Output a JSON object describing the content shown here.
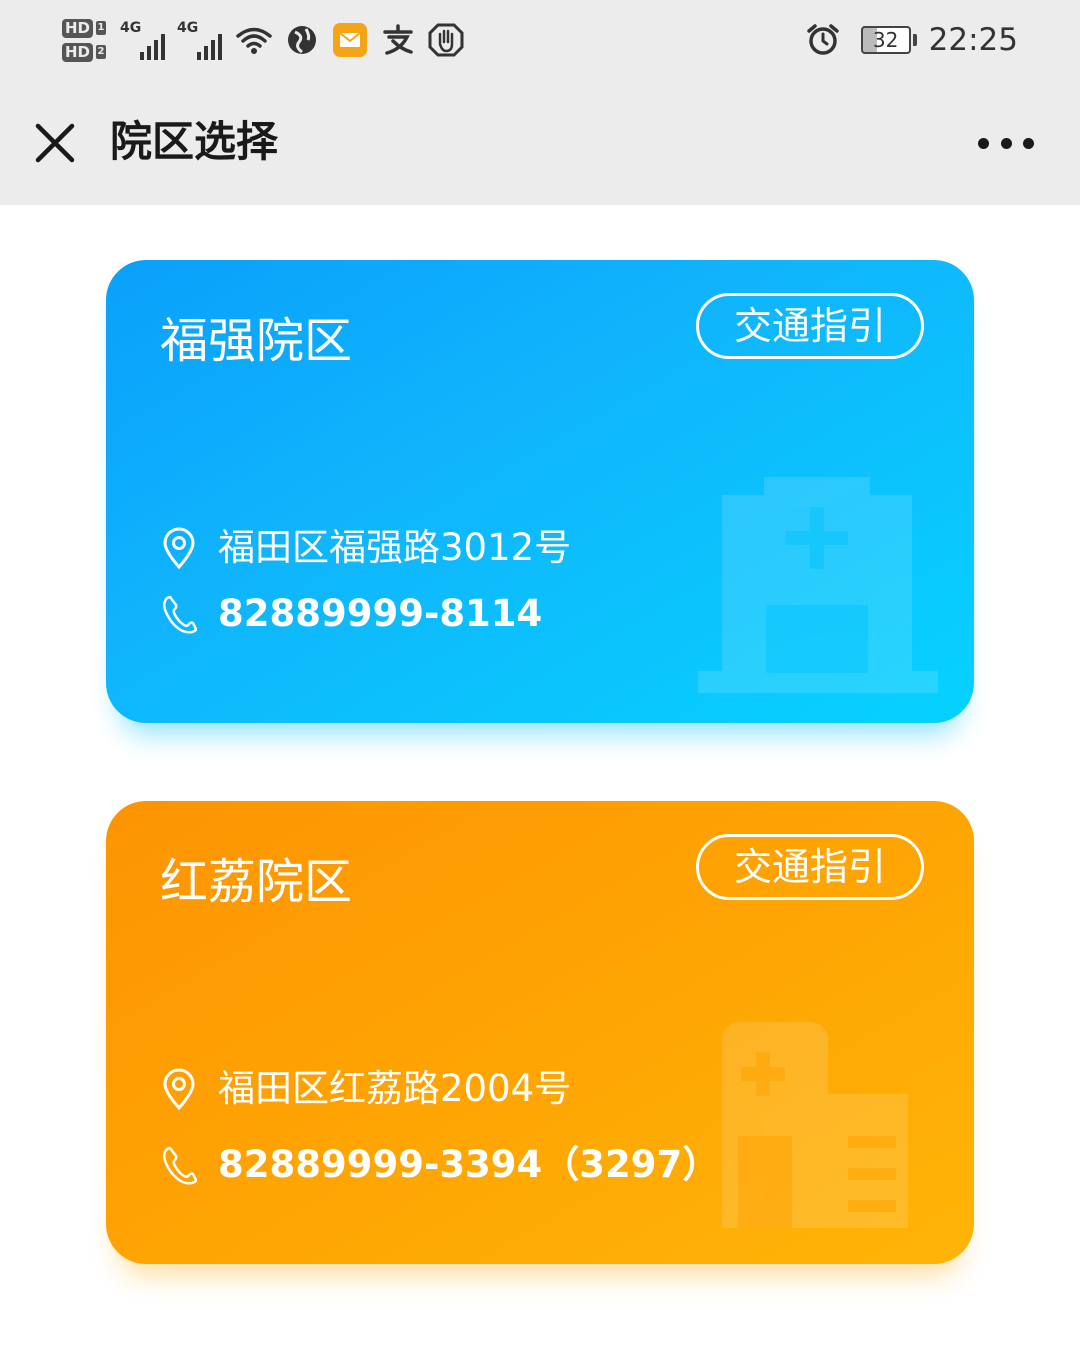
{
  "status_bar": {
    "hd1": "HD",
    "hd1_num": "1",
    "hd2": "HD",
    "hd2_num": "2",
    "net1": "4G",
    "net2": "4G",
    "battery": "32",
    "time": "22:25",
    "icons": [
      "wifi-icon",
      "browser-icon",
      "mail-icon",
      "alipay-icon",
      "hand-icon",
      "alarm-icon"
    ]
  },
  "header": {
    "title": "院区选择"
  },
  "cards": [
    {
      "name": "福强院区",
      "guide_label": "交通指引",
      "address": "福田区福强路3012号",
      "phone": "82889999-8114",
      "color_start": "#0aa0fb",
      "color_end": "#06d2fe"
    },
    {
      "name": "红荔院区",
      "guide_label": "交通指引",
      "address": "福田区红荔路2004号",
      "phone": "82889999-3394（3297）",
      "color_start": "#fd9403",
      "color_end": "#ffb507"
    }
  ]
}
